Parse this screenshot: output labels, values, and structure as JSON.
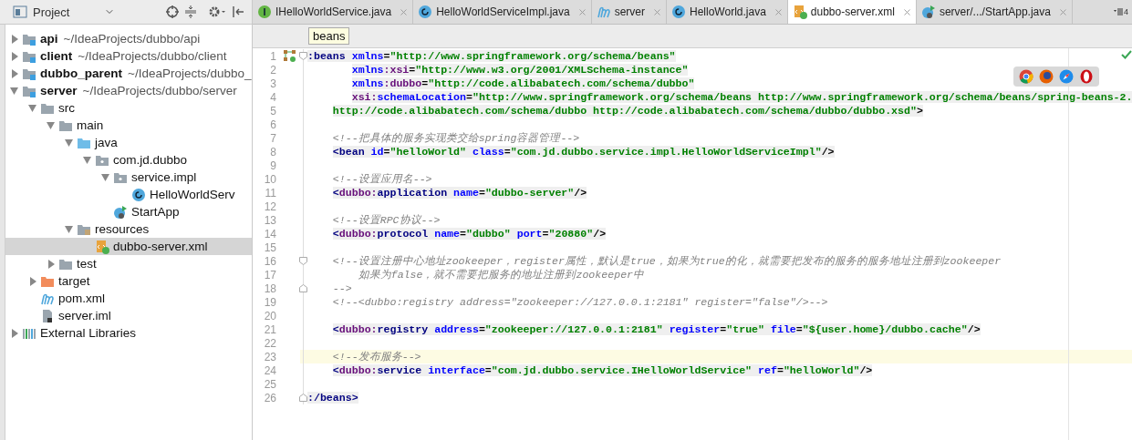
{
  "project_panel": {
    "title": "Project",
    "tree": [
      {
        "label": "api",
        "path": "~/IdeaProjects/dubbo/api",
        "kind": "module",
        "expanded": false,
        "selected": false
      },
      {
        "label": "client",
        "path": "~/IdeaProjects/dubbo/client",
        "kind": "module",
        "expanded": false,
        "selected": false
      },
      {
        "label": "dubbo_parent",
        "path": "~/IdeaProjects/dubbo_",
        "kind": "module",
        "expanded": false,
        "selected": false
      },
      {
        "label": "server",
        "path": "~/IdeaProjects/dubbo/server",
        "kind": "module",
        "expanded": true,
        "selected": false,
        "children": [
          {
            "label": "src",
            "kind": "folder",
            "expanded": true,
            "selected": false,
            "children": [
              {
                "label": "main",
                "kind": "folder",
                "expanded": true,
                "selected": false,
                "children": [
                  {
                    "label": "java",
                    "kind": "source",
                    "expanded": true,
                    "selected": false,
                    "children": [
                      {
                        "label": "com.jd.dubbo",
                        "kind": "package",
                        "expanded": true,
                        "selected": false,
                        "children": [
                          {
                            "label": "service.impl",
                            "kind": "package",
                            "expanded": true,
                            "selected": false,
                            "children": [
                              {
                                "label": "HelloWorldServ",
                                "kind": "class",
                                "selected": false
                              }
                            ]
                          },
                          {
                            "label": "StartApp",
                            "kind": "app",
                            "selected": false
                          }
                        ]
                      }
                    ]
                  },
                  {
                    "label": "resources",
                    "kind": "resources",
                    "expanded": true,
                    "selected": false,
                    "children": [
                      {
                        "label": "dubbo-server.xml",
                        "kind": "xml",
                        "selected": true
                      }
                    ]
                  }
                ]
              },
              {
                "label": "test",
                "kind": "folder",
                "expanded": false,
                "selected": false
              }
            ]
          },
          {
            "label": "target",
            "kind": "target",
            "expanded": false,
            "selected": false
          },
          {
            "label": "pom.xml",
            "kind": "maven",
            "selected": false
          },
          {
            "label": "server.iml",
            "kind": "iml",
            "selected": false
          }
        ]
      },
      {
        "label": "External Libraries",
        "kind": "libraries",
        "expanded": false,
        "selected": false
      }
    ]
  },
  "tabs": [
    {
      "label": "IHelloWorldService.java",
      "kind": "interface",
      "selected": false
    },
    {
      "label": "HelloWorldServiceImpl.java",
      "kind": "class",
      "selected": false
    },
    {
      "label": "server",
      "kind": "maven",
      "selected": false
    },
    {
      "label": "HelloWorld.java",
      "kind": "class",
      "selected": false
    },
    {
      "label": "dubbo-server.xml",
      "kind": "xml",
      "selected": true
    },
    {
      "label": "server/.../StartApp.java",
      "kind": "app",
      "selected": false
    }
  ],
  "hidden_tabs_count": "4",
  "breadcrumb": "beans",
  "editor": {
    "lines": [
      {
        "n": "1",
        "kind": "tag",
        "bean_marker": true,
        "fold_start": true,
        "tokens": [
          {
            "kind": "tag",
            "text": ":beans "
          },
          {
            "kind": "attr",
            "text": "xmlns"
          },
          {
            "kind": "p",
            "text": "="
          },
          {
            "kind": "val",
            "text": "\"http://www.springframework.org/schema/beans\""
          }
        ]
      },
      {
        "n": "2",
        "kind": "tag",
        "tokens": [
          {
            "kind": "attr",
            "text": "       xmlns"
          },
          {
            "kind": "ns",
            "text": ":xsi"
          },
          {
            "kind": "p",
            "text": "="
          },
          {
            "kind": "val",
            "text": "\"http://www.w3.org/2001/XMLSchema-instance\""
          }
        ]
      },
      {
        "n": "3",
        "kind": "tag",
        "tokens": [
          {
            "kind": "attr",
            "text": "       xmlns"
          },
          {
            "kind": "ns",
            "text": ":dubbo"
          },
          {
            "kind": "p",
            "text": "="
          },
          {
            "kind": "val",
            "text": "\"http://code.alibabatech.com/schema/dubbo\""
          }
        ]
      },
      {
        "n": "4",
        "kind": "tag",
        "tokens": [
          {
            "kind": "ns",
            "text": "       xsi:"
          },
          {
            "kind": "attr",
            "text": "schemaLocation"
          },
          {
            "kind": "p",
            "text": "="
          },
          {
            "kind": "val",
            "text": "\"http://www.springframework.org/schema/beans http://www.springframework.org/schema/beans/spring-beans-2."
          }
        ]
      },
      {
        "n": "5",
        "kind": "tag",
        "tokens": [
          {
            "kind": "val",
            "text": "    http://code.alibabatech.com/schema/dubbo http://code.alibabatech.com/schema/dubbo/dubbo.xsd\""
          },
          {
            "kind": "p",
            "text": ">"
          }
        ]
      },
      {
        "n": "6",
        "kind": "blank"
      },
      {
        "n": "7",
        "kind": "comment",
        "text": "    <!--把具体的服务实现类交给spring容器管理-->"
      },
      {
        "n": "8",
        "kind": "tag",
        "tokens": [
          {
            "kind": "tag",
            "text": "    <bean "
          },
          {
            "kind": "attr",
            "text": "id"
          },
          {
            "kind": "p",
            "text": "="
          },
          {
            "kind": "val",
            "text": "\"helloWorld\" "
          },
          {
            "kind": "attr",
            "text": "class"
          },
          {
            "kind": "p",
            "text": "="
          },
          {
            "kind": "val",
            "text": "\"com.jd.dubbo.service.impl.HelloWorldServiceImpl\""
          },
          {
            "kind": "p",
            "text": "/>"
          }
        ]
      },
      {
        "n": "9",
        "kind": "blank"
      },
      {
        "n": "10",
        "kind": "comment",
        "text": "    <!--设置应用名-->"
      },
      {
        "n": "11",
        "kind": "tag",
        "tokens": [
          {
            "kind": "tag",
            "text": "    <"
          },
          {
            "kind": "ns",
            "text": "dubbo:"
          },
          {
            "kind": "tag",
            "text": "application "
          },
          {
            "kind": "attr",
            "text": "name"
          },
          {
            "kind": "p",
            "text": "="
          },
          {
            "kind": "val",
            "text": "\"dubbo-server\""
          },
          {
            "kind": "p",
            "text": "/>"
          }
        ]
      },
      {
        "n": "12",
        "kind": "blank"
      },
      {
        "n": "13",
        "kind": "comment",
        "text": "    <!--设置RPC协议-->"
      },
      {
        "n": "14",
        "kind": "tag",
        "tokens": [
          {
            "kind": "tag",
            "text": "    <"
          },
          {
            "kind": "ns",
            "text": "dubbo:"
          },
          {
            "kind": "tag",
            "text": "protocol "
          },
          {
            "kind": "attr",
            "text": "name"
          },
          {
            "kind": "p",
            "text": "="
          },
          {
            "kind": "val",
            "text": "\"dubbo\" "
          },
          {
            "kind": "attr",
            "text": "port"
          },
          {
            "kind": "p",
            "text": "="
          },
          {
            "kind": "val",
            "text": "\"20880\""
          },
          {
            "kind": "p",
            "text": "/>"
          }
        ]
      },
      {
        "n": "15",
        "kind": "blank"
      },
      {
        "n": "16",
        "kind": "comment",
        "fold_start": true,
        "text": "    <!--设置注册中心地址zookeeper，register属性，默认是true，如果为true的化，就需要把发布的服务的服务地址注册到zookeeper"
      },
      {
        "n": "17",
        "kind": "comment",
        "text": "        如果为false，就不需要把服务的地址注册到zookeeper中"
      },
      {
        "n": "18",
        "kind": "comment",
        "fold_end": true,
        "text": "    -->"
      },
      {
        "n": "19",
        "kind": "comment",
        "text": "    <!--<dubbo:registry address=\"zookeeper://127.0.0.1:2181\" register=\"false\"/>-->"
      },
      {
        "n": "20",
        "kind": "blank"
      },
      {
        "n": "21",
        "kind": "tag",
        "tokens": [
          {
            "kind": "tag",
            "text": "    <"
          },
          {
            "kind": "ns",
            "text": "dubbo:"
          },
          {
            "kind": "tag",
            "text": "registry "
          },
          {
            "kind": "attr",
            "text": "address"
          },
          {
            "kind": "p",
            "text": "="
          },
          {
            "kind": "val",
            "text": "\"zookeeper://127.0.0.1:2181\" "
          },
          {
            "kind": "attr",
            "text": "register"
          },
          {
            "kind": "p",
            "text": "="
          },
          {
            "kind": "val",
            "text": "\"true\" "
          },
          {
            "kind": "attr",
            "text": "file"
          },
          {
            "kind": "p",
            "text": "="
          },
          {
            "kind": "val",
            "text": "\"${user.home}/dubbo.cache\""
          },
          {
            "kind": "p",
            "text": "/>"
          }
        ]
      },
      {
        "n": "22",
        "kind": "blank"
      },
      {
        "n": "23",
        "kind": "comment",
        "current": true,
        "text": "    <!--发布服务-->"
      },
      {
        "n": "24",
        "kind": "tag",
        "tokens": [
          {
            "kind": "tag",
            "text": "    <"
          },
          {
            "kind": "ns",
            "text": "dubbo:"
          },
          {
            "kind": "tag",
            "text": "service "
          },
          {
            "kind": "attr",
            "text": "interface"
          },
          {
            "kind": "p",
            "text": "="
          },
          {
            "kind": "val",
            "text": "\"com.jd.dubbo.service.IHelloWorldService\" "
          },
          {
            "kind": "attr",
            "text": "ref"
          },
          {
            "kind": "p",
            "text": "="
          },
          {
            "kind": "val",
            "text": "\"helloWorld\""
          },
          {
            "kind": "p",
            "text": "/>"
          }
        ]
      },
      {
        "n": "25",
        "kind": "blank"
      },
      {
        "n": "26",
        "kind": "tag",
        "fold_end": true,
        "tokens": [
          {
            "kind": "tag",
            "text": ":/beans>"
          }
        ]
      }
    ]
  }
}
